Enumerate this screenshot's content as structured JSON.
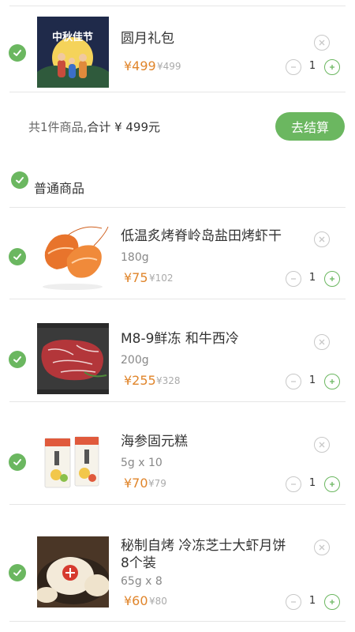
{
  "colors": {
    "accent": "#6bb760",
    "price": "#e0852b"
  },
  "gift": {
    "title": "圆月礼包",
    "banner_text": "中秋佳节",
    "price": "¥499",
    "old_price": "¥499",
    "qty": "1",
    "summary_prefix": "共1件商品,",
    "summary_total": "合计 ¥ 499元",
    "checkout": "去结算"
  },
  "section": {
    "label": "普通商品"
  },
  "items": [
    {
      "title": "低温炙烤脊岭岛盐田烤虾干",
      "spec": "180g",
      "price": "¥75",
      "old_price": "¥102",
      "qty": "1",
      "image": "dried-shrimp"
    },
    {
      "title": "M8-9鲜冻 和牛西冷",
      "spec": "200g",
      "price": "¥255",
      "old_price": "¥328",
      "qty": "1",
      "image": "wagyu-steak"
    },
    {
      "title": "海参固元糕",
      "spec": "5g x 10",
      "price": "¥70",
      "old_price": "¥79",
      "qty": "1",
      "image": "sea-cucumber-cake"
    },
    {
      "title_line1": "秘制自烤 冷冻芝士大虾月饼",
      "title_line2": "8个装",
      "spec": "65g x 8",
      "price": "¥60",
      "old_price": "¥80",
      "qty": "1",
      "image": "mooncake"
    }
  ],
  "icons": {
    "check": "check-icon",
    "remove": "close-icon",
    "minus": "minus-icon",
    "plus": "plus-icon"
  }
}
